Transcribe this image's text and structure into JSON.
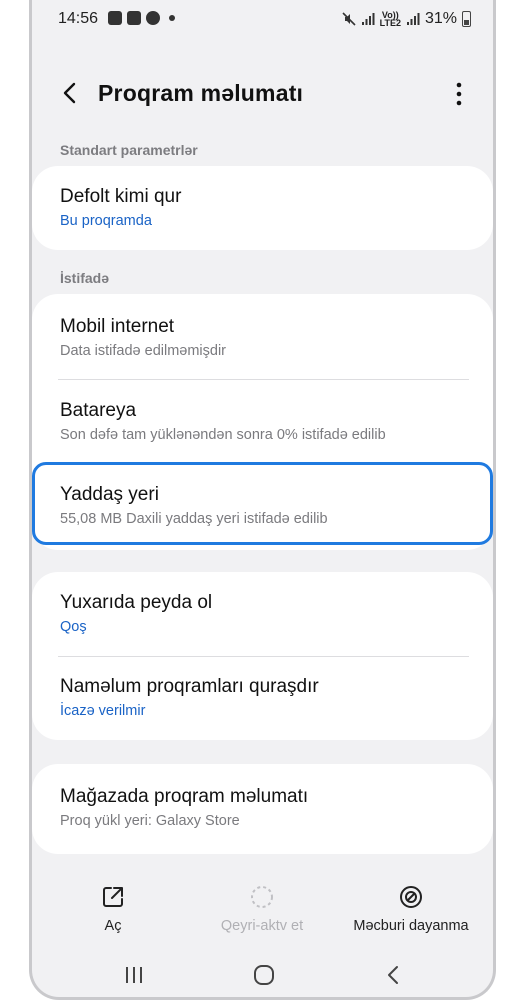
{
  "status": {
    "time": "14:56",
    "battery": "31%",
    "net_top": "Vo))",
    "net_bottom": "LTE2"
  },
  "header": {
    "title": "Proqram məlumatı"
  },
  "sections": {
    "standard_label": "Standart parametrlər",
    "usage_label": "İstifadə"
  },
  "items": {
    "default": {
      "title": "Defolt kimi qur",
      "subtitle": "Bu proqramda"
    },
    "mobile_internet": {
      "title": "Mobil internet",
      "subtitle": "Data istifadə edilməmişdir"
    },
    "battery": {
      "title": "Batareya",
      "subtitle": "Son dəfə tam yüklənəndən sonra 0% istifadə edilib"
    },
    "storage": {
      "title": "Yaddaş yeri",
      "subtitle": "55,08 MB Daxili yaddaş yeri istifadə edilib"
    },
    "appear_on_top": {
      "title": "Yuxarıda peyda ol",
      "subtitle": "Qoş"
    },
    "unknown_apps": {
      "title": "Naməlum proqramları quraşdır",
      "subtitle": "İcazə verilmir"
    },
    "store_info": {
      "title": "Mağazada proqram məlumatı",
      "subtitle": "Proq yükl yeri: Galaxy Store"
    }
  },
  "actions": {
    "open": "Aç",
    "disable": "Qeyri-aktv et",
    "force_stop": "Məcburi dayanma"
  },
  "colors": {
    "accent": "#1a63c6",
    "highlight": "#1f7ae0",
    "background": "#f1f1f3"
  }
}
